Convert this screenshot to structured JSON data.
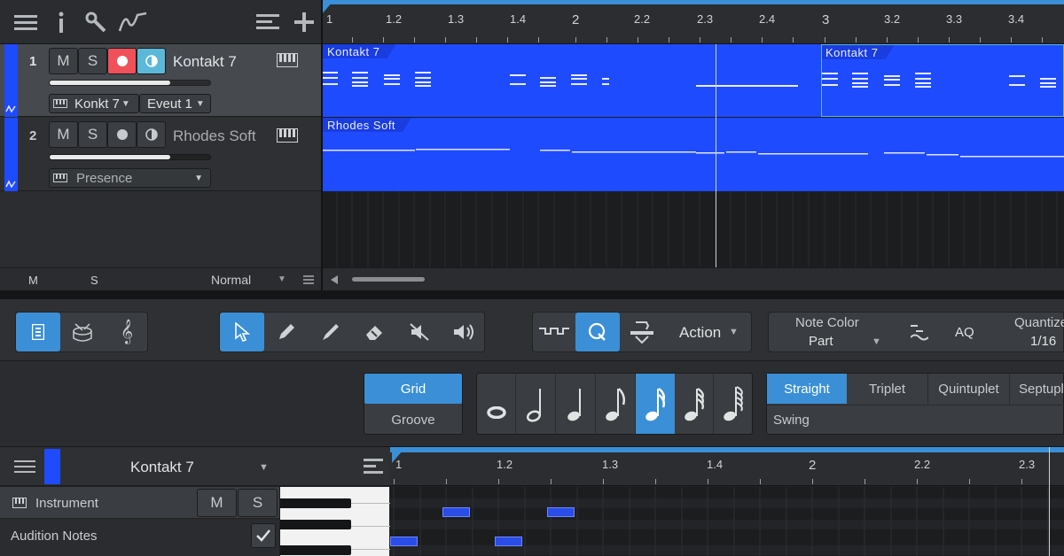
{
  "colors": {
    "accent": "#3a8fd6",
    "clip_blue": "#1f4bff",
    "rec_red": "#f0505a",
    "monitor_cyan": "#5cb8d8"
  },
  "arrange_ruler": {
    "labels": [
      "1",
      "1.2",
      "1.3",
      "1.4",
      "2",
      "2.2",
      "2.3",
      "2.4",
      "3",
      "3.2",
      "3.3",
      "3.4"
    ]
  },
  "tracks": [
    {
      "number": "1",
      "mute": "M",
      "solo": "S",
      "name": "Kontakt 7",
      "instrument": "Konkt 7",
      "output": "Eveut 1"
    },
    {
      "number": "2",
      "mute": "M",
      "solo": "S",
      "name": "Rhodes Soft",
      "preset": "Presence"
    }
  ],
  "clips": {
    "kontakt_a": "Kontakt 7",
    "kontakt_b": "Kontakt 7",
    "rhodes": "Rhodes Soft"
  },
  "track_footer": {
    "m": "M",
    "s": "S",
    "mode": "Normal"
  },
  "toolbar": {
    "action_label": "Action",
    "note_color_label": "Note Color",
    "note_color_value": "Part",
    "aq_label": "AQ",
    "quantize_label": "Quantize",
    "quantize_value": "1/16"
  },
  "quantize_panel": {
    "grid_label": "Grid",
    "groove_label": "Groove",
    "straight_label": "Straight",
    "triplet_label": "Triplet",
    "quintuplet_label": "Quintuplet",
    "septuplet_label": "Septuplet",
    "swing_label": "Swing"
  },
  "editor": {
    "track_name": "Kontakt 7",
    "instrument_label": "Instrument",
    "m": "M",
    "s": "S",
    "audition_label": "Audition Notes",
    "ruler_labels": [
      "1",
      "1.2",
      "1.3",
      "1.4",
      "2",
      "2.2",
      "2.3"
    ]
  }
}
